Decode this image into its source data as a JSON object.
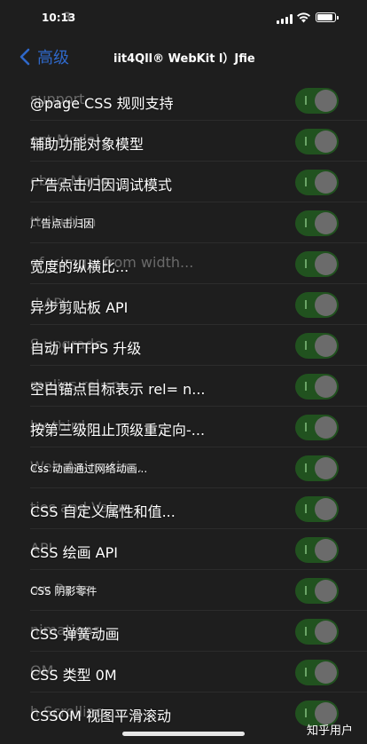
{
  "status_bar": {
    "time": "10:13",
    "time_ghost": "3"
  },
  "nav": {
    "back_label": "高级",
    "title": "iit4Qll® WebKit l）Jfie"
  },
  "rows": [
    {
      "label": "@page CSS 规则支持",
      "ghost": "              support",
      "small": false
    },
    {
      "label": "辅助功能对象模型",
      "ghost": "               ect Model",
      "small": false
    },
    {
      "label": "广告点击归因调试模式",
      "ghost": "                  ebug Mode",
      "small": false
    },
    {
      "label": "广告点击归因",
      "ghost": "           ttribution",
      "small": true
    },
    {
      "label": "宽度的纵横比...",
      "ghost": "           of <img> from width...",
      "small": false
    },
    {
      "label": "异步剪贴板 API",
      "ghost": "               d API",
      "small": false
    },
    {
      "label": "自动 HTTPS 升级",
      "ghost": "                  S upgrade",
      "small": false
    },
    {
      "label": "空白锚点目标表示 rel= n...",
      "ghost": "                mplies rel=n...",
      "small": false
    },
    {
      "label": "按第三级阻止顶级重定向-...",
      "ghost": "                  by third-",
      "small": false
    },
    {
      "label": "Css 动画通过网络动画...",
      "ghost": "                  Web Animatio...",
      "small": true
    },
    {
      "label": "CSS 自定义属性和值...",
      "ghost": "                    ties and Value...",
      "small": false
    },
    {
      "label": "CSS 绘画 API",
      "ghost": "              API",
      "small": false
    },
    {
      "label": "CSS 阴影零件",
      "ghost": "            ow Parts",
      "small": true
    },
    {
      "label": "CSS 弹簧动画",
      "ghost": "              nimations",
      "small": false
    },
    {
      "label": "CSS 类型 0M",
      "ghost": "              OM",
      "small": false
    },
    {
      "label": "CSSOM 视图平滑滚动",
      "ghost": "                   h Scrolling",
      "small": false
    }
  ],
  "watermark": "知乎用户",
  "colors": {
    "toggle_on": "#21521f",
    "link": "#2f68c9",
    "background": "#1e1e1e"
  }
}
